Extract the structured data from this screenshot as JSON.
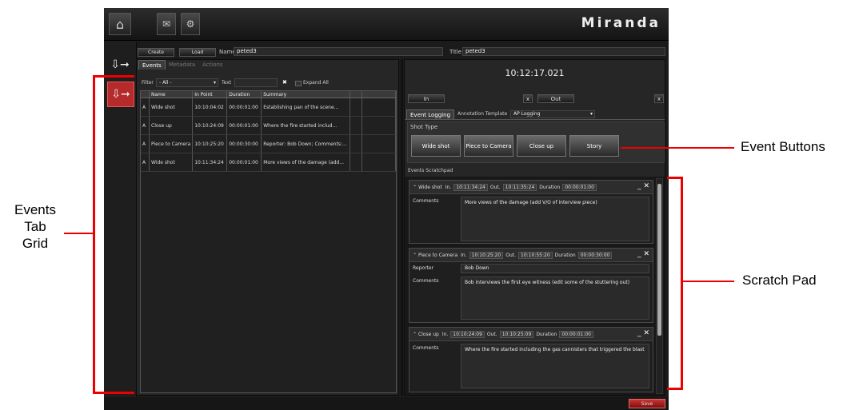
{
  "topbar": {
    "brand": "Miranda"
  },
  "header": {
    "create_label": "Create",
    "load_label": "Load",
    "name_label": "Name",
    "name_value": "peted3",
    "title_label": "Title",
    "title_value": "peted3"
  },
  "left_tabs": [
    "Events",
    "Metadata",
    "Actions"
  ],
  "filter": {
    "label": "Filter",
    "value": "- All -",
    "text_label": "Text",
    "clear": "✖",
    "expand_label": "Expand All"
  },
  "grid": {
    "columns": [
      "Name",
      "In Point",
      "Duration",
      "Summary"
    ],
    "rows": [
      {
        "flag": "A",
        "name": "Wide shot",
        "in": "10:10:04:02",
        "dur": "00:00:01:00",
        "summary": "Establishing pan of the scene..."
      },
      {
        "flag": "A",
        "name": "Close up",
        "in": "10:10:24:09",
        "dur": "00:00:01:00",
        "summary": "Where the fire started includ..."
      },
      {
        "flag": "A",
        "name": "Piece to Camera",
        "in": "10:10:25:20",
        "dur": "00:00:30:00",
        "summary": "Reporter: Bob Down; Comments:..."
      },
      {
        "flag": "A",
        "name": "Wide shot",
        "in": "10:11:34:24",
        "dur": "00:00:01:00",
        "summary": "More views of the damage (add..."
      }
    ]
  },
  "timecode": "10:12:17.021",
  "in_out": {
    "in_label": "In",
    "out_label": "Out",
    "x": "x"
  },
  "right_tabs": {
    "event_logging": "Event Logging",
    "annotation_label": "Annotation Template",
    "annotation_value": "AP Logging"
  },
  "shot_type": {
    "title": "Shot Type",
    "buttons": [
      "Wide shot",
      "Piece to Camera",
      "Close up",
      "Story"
    ]
  },
  "scratchpad": {
    "title": "Events Scratchpad",
    "in_label": "In.",
    "out_label": "Out.",
    "duration_label": "Duration",
    "comments_label": "Comments",
    "reporter_label": "Reporter",
    "entries": [
      {
        "name": "Wide shot",
        "in": "10:11:34:24",
        "out": "10:11:35:24",
        "duration": "00:00:01:00",
        "comments": "More views of the damage (add V/O of interview piece)"
      },
      {
        "name": "Piece to Camera",
        "in": "10:10:25:20",
        "out": "10:10:55:20",
        "duration": "00:00:30:00",
        "reporter": "Bob Down",
        "comments": "Bob interviews the first eye witness (edit some of the stuttering out)"
      },
      {
        "name": "Close up",
        "in": "10:10:24:09",
        "out": "10:10:25:09",
        "duration": "00:00:01:00",
        "comments": "Where the fire started including the gas cannisters that triggered the blast"
      }
    ]
  },
  "save_label": "Save",
  "callouts": {
    "events_tab_grid": [
      "Events",
      "Tab",
      "Grid"
    ],
    "event_buttons": "Event Buttons",
    "scratch_pad": "Scratch Pad"
  }
}
